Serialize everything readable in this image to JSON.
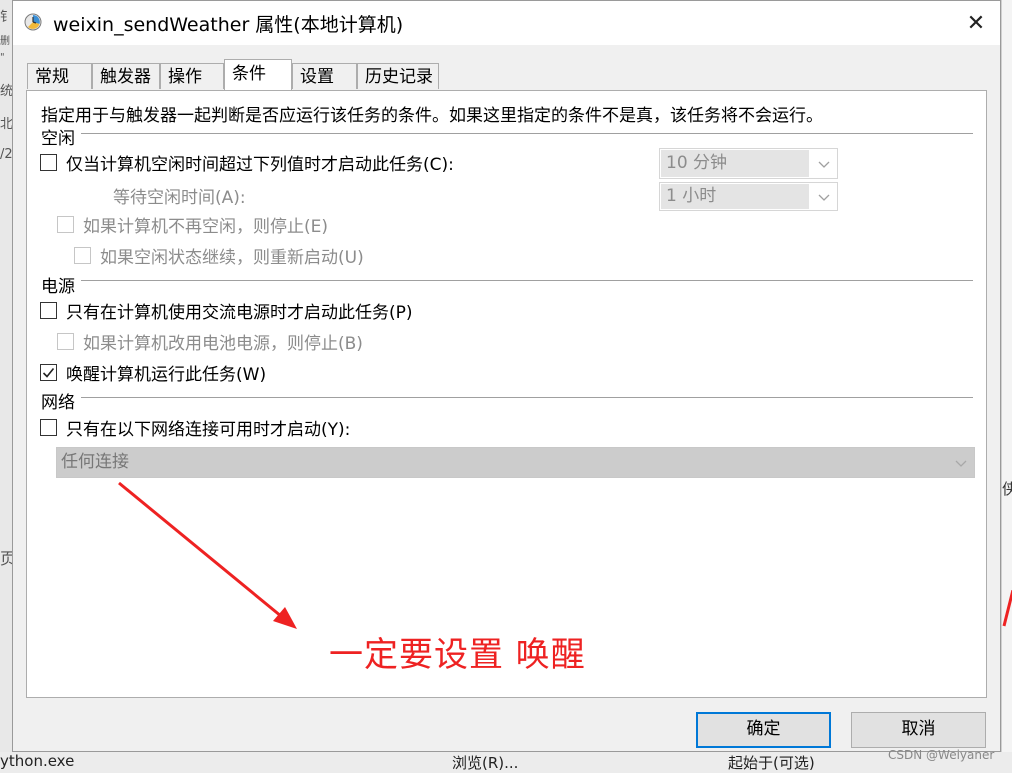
{
  "dialog": {
    "title": "weixin_sendWeather 属性(本地计算机)",
    "close_glyph": "✕"
  },
  "tabs": [
    {
      "label": "常规",
      "active": false
    },
    {
      "label": "触发器",
      "active": false
    },
    {
      "label": "操作",
      "active": false
    },
    {
      "label": "条件",
      "active": true
    },
    {
      "label": "设置",
      "active": false
    },
    {
      "label": "历史记录",
      "active": false
    }
  ],
  "conditions": {
    "description": "指定用于与触发器一起判断是否应运行该任务的条件。如果这里指定的条件不是真，该任务将不会运行。",
    "idle": {
      "section_label": "空闲",
      "start_if_idle": {
        "label": "仅当计算机空闲时间超过下列值时才启动此任务(C):",
        "checked": false
      },
      "idle_for_value": "10 分钟",
      "wait_label": "等待空闲时间(A):",
      "wait_value": "1 小时",
      "stop_if_not_idle": {
        "label": "如果计算机不再空闲，则停止(E)",
        "checked": false,
        "enabled": false
      },
      "restart_if_idle": {
        "label": "如果空闲状态继续，则重新启动(U)",
        "checked": false,
        "enabled": false
      }
    },
    "power": {
      "section_label": "电源",
      "ac_only": {
        "label": "只有在计算机使用交流电源时才启动此任务(P)",
        "checked": false
      },
      "stop_on_battery": {
        "label": "如果计算机改用电池电源，则停止(B)",
        "checked": false,
        "enabled": false
      },
      "wake_to_run": {
        "label": "唤醒计算机运行此任务(W)",
        "checked": true
      }
    },
    "network": {
      "section_label": "网络",
      "network_only": {
        "label": "只有在以下网络连接可用时才启动(Y):",
        "checked": false
      },
      "connection_value": "任何连接"
    }
  },
  "annotation": {
    "text": "一定要设置 唤醒",
    "color": "#ee2222"
  },
  "buttons": {
    "ok": "确定",
    "cancel": "取消"
  },
  "background": {
    "left_fragments": [
      "钅",
      "删",
      "\"",
      "统",
      "北",
      "/2",
      "页"
    ],
    "right_fragment": "侠",
    "bottom_left": "ython.exe",
    "bottom_mid": "浏览(R)...",
    "bottom_right": "起始于(可选)"
  },
  "watermark": "CSDN @Weiyaner",
  "colors": {
    "accent": "#0078d7",
    "annotation_red": "#ee2222",
    "panel": "#ffffff",
    "window": "#f0f0f0"
  }
}
